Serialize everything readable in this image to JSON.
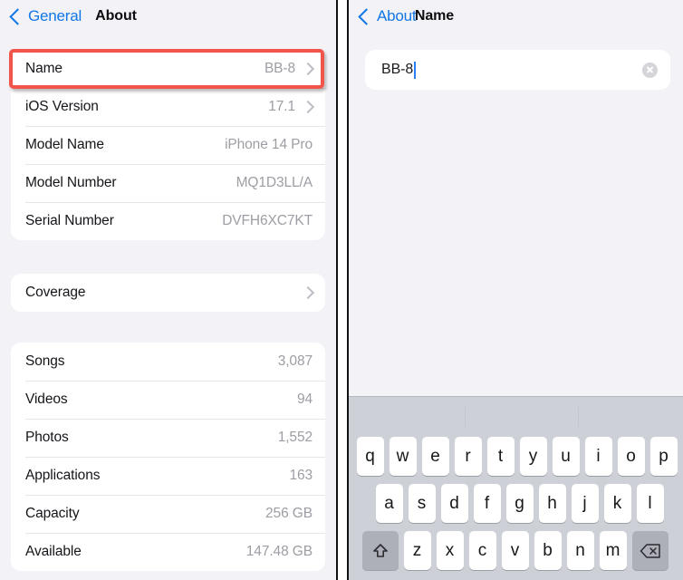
{
  "left_panel": {
    "nav": {
      "back_label": "General",
      "back_icon": "chevron-left-icon",
      "title": "About"
    },
    "groups": [
      {
        "name": "device-info-group",
        "rows": [
          {
            "label": "Name",
            "value": "BB-8",
            "chevron": true,
            "highlighted": true
          },
          {
            "label": "iOS Version",
            "value": "17.1",
            "chevron": true
          },
          {
            "label": "Model Name",
            "value": "iPhone 14 Pro",
            "chevron": false
          },
          {
            "label": "Model Number",
            "value": "MQ1D3LL/A",
            "chevron": false
          },
          {
            "label": "Serial Number",
            "value": "DVFH6XC7KT",
            "chevron": false
          }
        ]
      },
      {
        "name": "coverage-group",
        "rows": [
          {
            "label": "Coverage",
            "value": "",
            "chevron": true
          }
        ]
      },
      {
        "name": "storage-stats-group",
        "rows": [
          {
            "label": "Songs",
            "value": "3,087",
            "chevron": false
          },
          {
            "label": "Videos",
            "value": "94",
            "chevron": false
          },
          {
            "label": "Photos",
            "value": "1,552",
            "chevron": false
          },
          {
            "label": "Applications",
            "value": "163",
            "chevron": false
          },
          {
            "label": "Capacity",
            "value": "256 GB",
            "chevron": false
          },
          {
            "label": "Available",
            "value": "147.48 GB",
            "chevron": false
          }
        ]
      }
    ]
  },
  "right_panel": {
    "nav": {
      "back_label": "About",
      "back_icon": "chevron-left-icon",
      "title": "Name"
    },
    "name_field": {
      "value": "BB-8",
      "placeholder": "Name",
      "clear_icon": "clear-circle-icon"
    },
    "keyboard": {
      "row1": [
        "q",
        "w",
        "e",
        "r",
        "t",
        "y",
        "u",
        "i",
        "o",
        "p"
      ],
      "row2": [
        "a",
        "s",
        "d",
        "f",
        "g",
        "h",
        "j",
        "k",
        "l"
      ],
      "row3": [
        "z",
        "x",
        "c",
        "v",
        "b",
        "n",
        "m"
      ],
      "shift_icon": "shift-arrow-icon",
      "delete_icon": "backspace-icon"
    }
  },
  "colors": {
    "accent_blue": "#1177e6",
    "highlight_red": "#f0544a",
    "list_background": "#f2f2f7",
    "row_background": "#ffffff",
    "value_gray": "#9d9da4",
    "keyboard_background": "#cdd0d6"
  }
}
